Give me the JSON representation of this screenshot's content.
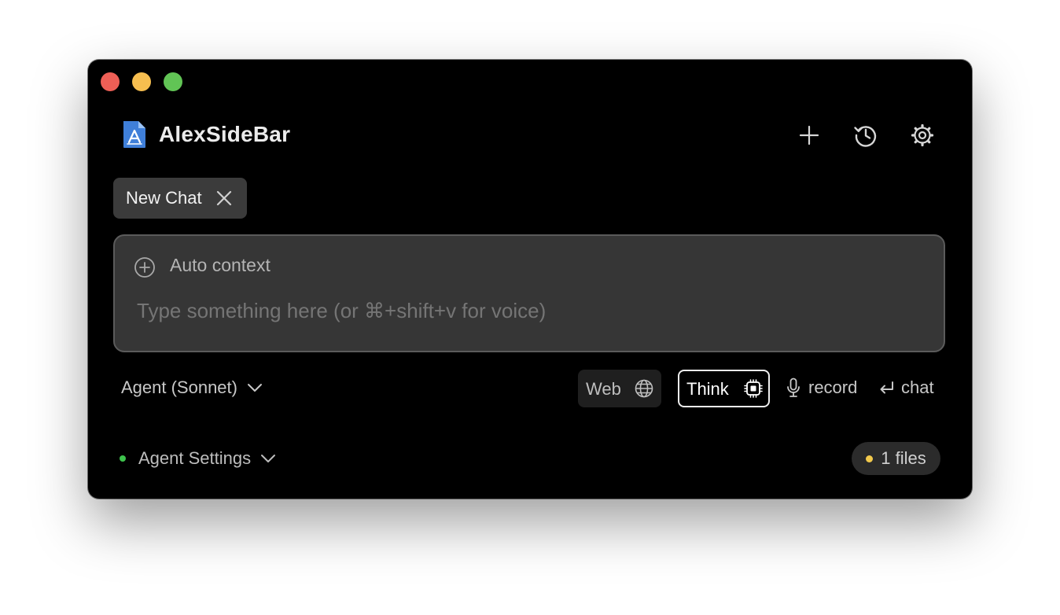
{
  "app": {
    "title": "AlexSideBar",
    "icons": {
      "app": "app-document-icon",
      "new": "plus-icon",
      "history": "history-icon",
      "settings": "gear-icon"
    }
  },
  "tab": {
    "label": "New Chat",
    "close_icon": "close-icon"
  },
  "input": {
    "context_label": "Auto context",
    "context_icon": "circle-plus-icon",
    "placeholder": "Type something here (or ⌘+shift+v for voice)",
    "value": ""
  },
  "toolbar": {
    "model_label": "Agent (Sonnet)",
    "web_label": "Web",
    "web_icon": "globe-icon",
    "think_label": "Think",
    "think_icon": "cpu-chip-icon",
    "record_label": "record",
    "record_icon": "microphone-icon",
    "chat_label": "chat",
    "chat_icon": "return-arrow-icon"
  },
  "footer": {
    "settings_label": "Agent Settings",
    "files_label": "1 files"
  },
  "colors": {
    "window_bg": "#000000",
    "tab_bg": "#3b3b3b",
    "input_bg": "#363636",
    "status_green": "#3ec34d",
    "files_yellow": "#f2c94c",
    "close": "#ee5f56",
    "minimize": "#f6be4f",
    "zoom": "#61c455"
  }
}
